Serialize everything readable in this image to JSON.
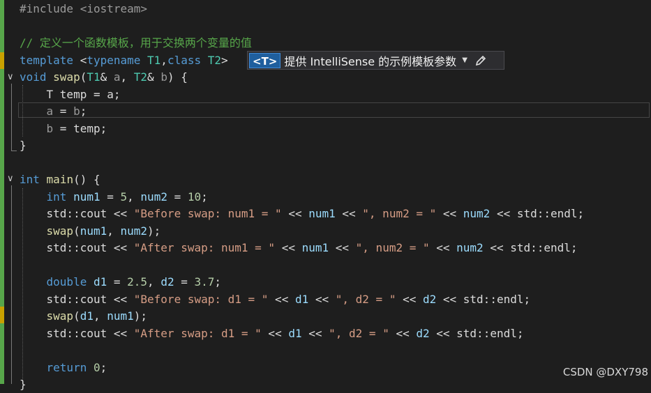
{
  "editor": {
    "lines": [
      {
        "id": "l1",
        "tokens": [
          [
            "pp",
            "#include "
          ],
          [
            "pp",
            "<iostream>"
          ]
        ]
      },
      {
        "id": "l2",
        "tokens": []
      },
      {
        "id": "l3",
        "tokens": [
          [
            "com",
            "// 定义一个函数模板，用于交换两个变量的值"
          ]
        ]
      },
      {
        "id": "l4",
        "tokens": [
          [
            "kw",
            "template"
          ],
          [
            "txt",
            " <"
          ],
          [
            "kw",
            "typename"
          ],
          [
            "txt",
            " "
          ],
          [
            "type",
            "T1"
          ],
          [
            "txt",
            ","
          ],
          [
            "kw",
            "class"
          ],
          [
            "txt",
            " "
          ],
          [
            "type",
            "T2"
          ],
          [
            "txt",
            ">"
          ]
        ]
      },
      {
        "id": "l5",
        "tokens": [
          [
            "kw",
            "void"
          ],
          [
            "txt",
            " "
          ],
          [
            "fn",
            "swap"
          ],
          [
            "txt",
            "("
          ],
          [
            "type",
            "T1"
          ],
          [
            "txt",
            "& "
          ],
          [
            "param",
            "a"
          ],
          [
            "txt",
            ", "
          ],
          [
            "type",
            "T2"
          ],
          [
            "txt",
            "& "
          ],
          [
            "param",
            "b"
          ],
          [
            "txt",
            ") {"
          ]
        ]
      },
      {
        "id": "l6",
        "tokens": [
          [
            "txt",
            "    T temp = a;"
          ]
        ]
      },
      {
        "id": "l7",
        "tokens": [
          [
            "param",
            "    a"
          ],
          [
            "txt",
            " = "
          ],
          [
            "param",
            "b"
          ],
          [
            "txt",
            ";"
          ]
        ]
      },
      {
        "id": "l8",
        "tokens": [
          [
            "param",
            "    b"
          ],
          [
            "txt",
            " = temp;"
          ]
        ]
      },
      {
        "id": "l9",
        "tokens": [
          [
            "txt",
            "}"
          ]
        ]
      },
      {
        "id": "l10",
        "tokens": []
      },
      {
        "id": "l11",
        "tokens": [
          [
            "kw",
            "int"
          ],
          [
            "txt",
            " "
          ],
          [
            "fn",
            "main"
          ],
          [
            "txt",
            "() {"
          ]
        ]
      },
      {
        "id": "l12",
        "tokens": [
          [
            "txt",
            "    "
          ],
          [
            "kw",
            "int"
          ],
          [
            "txt",
            " "
          ],
          [
            "var",
            "num1"
          ],
          [
            "txt",
            " = "
          ],
          [
            "num",
            "5"
          ],
          [
            "txt",
            ", "
          ],
          [
            "var",
            "num2"
          ],
          [
            "txt",
            " = "
          ],
          [
            "num",
            "10"
          ],
          [
            "txt",
            ";"
          ]
        ]
      },
      {
        "id": "l13",
        "tokens": [
          [
            "txt",
            "    std::cout << "
          ],
          [
            "str",
            "\"Before swap: num1 = \""
          ],
          [
            "txt",
            " << "
          ],
          [
            "var",
            "num1"
          ],
          [
            "txt",
            " << "
          ],
          [
            "str",
            "\", num2 = \""
          ],
          [
            "txt",
            " << "
          ],
          [
            "var",
            "num2"
          ],
          [
            "txt",
            " << std::endl;"
          ]
        ]
      },
      {
        "id": "l14",
        "tokens": [
          [
            "txt",
            "    "
          ],
          [
            "fn",
            "swap"
          ],
          [
            "txt",
            "("
          ],
          [
            "var",
            "num1"
          ],
          [
            "txt",
            ", "
          ],
          [
            "var",
            "num2"
          ],
          [
            "txt",
            ");"
          ]
        ]
      },
      {
        "id": "l15",
        "tokens": [
          [
            "txt",
            "    std::cout << "
          ],
          [
            "str",
            "\"After swap: num1 = \""
          ],
          [
            "txt",
            " << "
          ],
          [
            "var",
            "num1"
          ],
          [
            "txt",
            " << "
          ],
          [
            "str",
            "\", num2 = \""
          ],
          [
            "txt",
            " << "
          ],
          [
            "var",
            "num2"
          ],
          [
            "txt",
            " << std::endl;"
          ]
        ]
      },
      {
        "id": "l16",
        "tokens": []
      },
      {
        "id": "l17",
        "tokens": [
          [
            "txt",
            "    "
          ],
          [
            "kw",
            "double"
          ],
          [
            "txt",
            " "
          ],
          [
            "var",
            "d1"
          ],
          [
            "txt",
            " = "
          ],
          [
            "num",
            "2.5"
          ],
          [
            "txt",
            ", "
          ],
          [
            "var",
            "d2"
          ],
          [
            "txt",
            " = "
          ],
          [
            "num",
            "3.7"
          ],
          [
            "txt",
            ";"
          ]
        ]
      },
      {
        "id": "l18",
        "tokens": [
          [
            "txt",
            "    std::cout << "
          ],
          [
            "str",
            "\"Before swap: d1 = \""
          ],
          [
            "txt",
            " << "
          ],
          [
            "var",
            "d1"
          ],
          [
            "txt",
            " << "
          ],
          [
            "str",
            "\", d2 = \""
          ],
          [
            "txt",
            " << "
          ],
          [
            "var",
            "d2"
          ],
          [
            "txt",
            " << std::endl;"
          ]
        ]
      },
      {
        "id": "l19",
        "tokens": [
          [
            "txt",
            "    "
          ],
          [
            "fn",
            "swap"
          ],
          [
            "txt",
            "("
          ],
          [
            "var",
            "d1"
          ],
          [
            "txt",
            ", "
          ],
          [
            "var",
            "num1"
          ],
          [
            "txt",
            ");"
          ]
        ]
      },
      {
        "id": "l20",
        "tokens": [
          [
            "txt",
            "    std::cout << "
          ],
          [
            "str",
            "\"After swap: d1 = \""
          ],
          [
            "txt",
            " << "
          ],
          [
            "var",
            "d1"
          ],
          [
            "txt",
            " << "
          ],
          [
            "str",
            "\", d2 = \""
          ],
          [
            "txt",
            " << "
          ],
          [
            "var",
            "d2"
          ],
          [
            "txt",
            " << std::endl;"
          ]
        ]
      },
      {
        "id": "l21",
        "tokens": []
      },
      {
        "id": "l22",
        "tokens": [
          [
            "txt",
            "    "
          ],
          [
            "kw",
            "return"
          ],
          [
            "txt",
            " "
          ],
          [
            "num",
            "0"
          ],
          [
            "txt",
            ";"
          ]
        ]
      },
      {
        "id": "l23",
        "tokens": [
          [
            "txt",
            "}"
          ]
        ]
      }
    ]
  },
  "intellisense": {
    "tag": "<T>",
    "label": "提供 IntelliSense 的示例模板参数",
    "caret_icon": "chevron-down-icon",
    "edit_icon": "pencil-icon"
  },
  "watermark": {
    "text": "CSDN @DXY798"
  },
  "colors": {
    "keyword": "#569cd6",
    "type": "#4ec9b0",
    "function": "#dcdcaa",
    "variable": "#9cdcfe",
    "string": "#d69d85",
    "number": "#b5cea8",
    "comment": "#57a64a",
    "preprocessor": "#9b9b9b",
    "change_bar_green": "#57a64a",
    "change_bar_yellow": "#c8a100"
  }
}
